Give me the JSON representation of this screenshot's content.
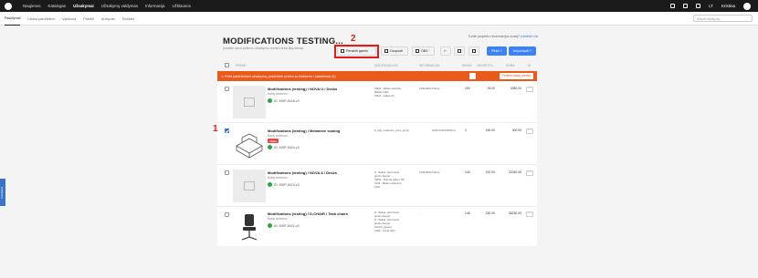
{
  "topnav": {
    "items": [
      {
        "label": "Naujienos",
        "active": false
      },
      {
        "label": "Katalogas",
        "active": false
      },
      {
        "label": "Užsakymai",
        "active": true
      },
      {
        "label": "Užsakymų valdymas",
        "active": false
      },
      {
        "label": "Informacija",
        "active": false
      },
      {
        "label": "Užklausos",
        "active": false
      }
    ],
    "lang": "LT",
    "user": "Kristina"
  },
  "subnav": {
    "items": [
      {
        "label": "Pasiūlymai",
        "active": true
      },
      {
        "label": "Laukia patvirtinimo",
        "active": false
      },
      {
        "label": "Vykdoma",
        "active": false
      },
      {
        "label": "Pateikti",
        "active": false
      },
      {
        "label": "Archyvas",
        "active": false
      },
      {
        "label": "Šiukšlės",
        "active": false
      }
    ],
    "search_placeholder": "Ieškoti užsakymų"
  },
  "page": {
    "help_text": "Turite projekto rezervacijos kodą?",
    "help_link": "Įveskite čia",
    "title": "MODIFICATIONS TESTING...",
    "subtitle": "Įveskite savo pirkimo užsakymo numerį arba kitą tekstą"
  },
  "toolbar": {
    "apply_label": "Perskirti gamin",
    "group_label": "Grupuoti",
    "obx_label": "OBX",
    "actions_label": "Pirkti ˅",
    "import_label": "Importuoti ˅"
  },
  "annotations": {
    "one": "1",
    "two": "2"
  },
  "table_header": {
    "product": "PREKĖ",
    "modifications": "MODIFIKACIJOS",
    "information": "INFORMACIJA",
    "qty": "KIEKIS",
    "unit_price": "VIENETO K...",
    "total": "SUMA"
  },
  "alert": {
    "message": "Prieš patvirtindami užsakymą, pašalinkite prekes su klaidomis / pakeitimais (2)",
    "button": "Perkelti klaidų prekes"
  },
  "rows": [
    {
      "name": "Modifications (testing) / NOVA U / Desks",
      "category": "Baldų sistemos",
      "id": "ID: MSP-5418-v3",
      "checked": false,
      "badge": "",
      "modifications": [
        "SM03 - Baltas stalviršis",
        "(Balta) 1400",
        "SM01 - baltas (K)"
      ],
      "info": "1600x800x740mm",
      "qty": "150",
      "unit_price": "29.00",
      "total": "4350.00"
    },
    {
      "name": "Modifications (testing) / Melamine seating",
      "category": "Baldų sistemos",
      "id": "ID: MSP-5424-v3",
      "checked": true,
      "badge": "Klaida",
      "modifications": [
        "Z_ttdp_melamine_price_group"
      ],
      "info": "3200x1500x2500mm",
      "qty": "2",
      "unit_price": "150.00",
      "total": "300.00"
    },
    {
      "name": "Modifications (testing) / NOVA A / Desks",
      "category": "Baldų sistemos",
      "id": "ID: MSP-5419-v3",
      "checked": false,
      "badge": "",
      "modifications": [
        "D - Baltas, skirti bazei",
        "grindų dangai",
        "SM03 - Melsvai pilka ir NK",
        "7003 - Baltas melamino",
        "1401"
      ],
      "info": "1600x800x740mm",
      "qty": "140",
      "unit_price": "152.00",
      "total": "22040.00"
    },
    {
      "name": "Modifications (testing) / D-CHAIR / Task chairs",
      "category": "Baldų sistemos",
      "id": "ID: MSP-5422-v3",
      "checked": false,
      "badge": "",
      "modifications": [
        "D - Baltas, skirti bazei",
        "grindų dangai",
        "D - Baltas, skirti bazei",
        "grindų dangai",
        "SAL03_(green)",
        "1408 - Juoda (R3)"
      ],
      "info": "-",
      "qty": "145",
      "unit_price": "230.00",
      "total": "35230.00"
    }
  ],
  "feedback": "Feedback"
}
